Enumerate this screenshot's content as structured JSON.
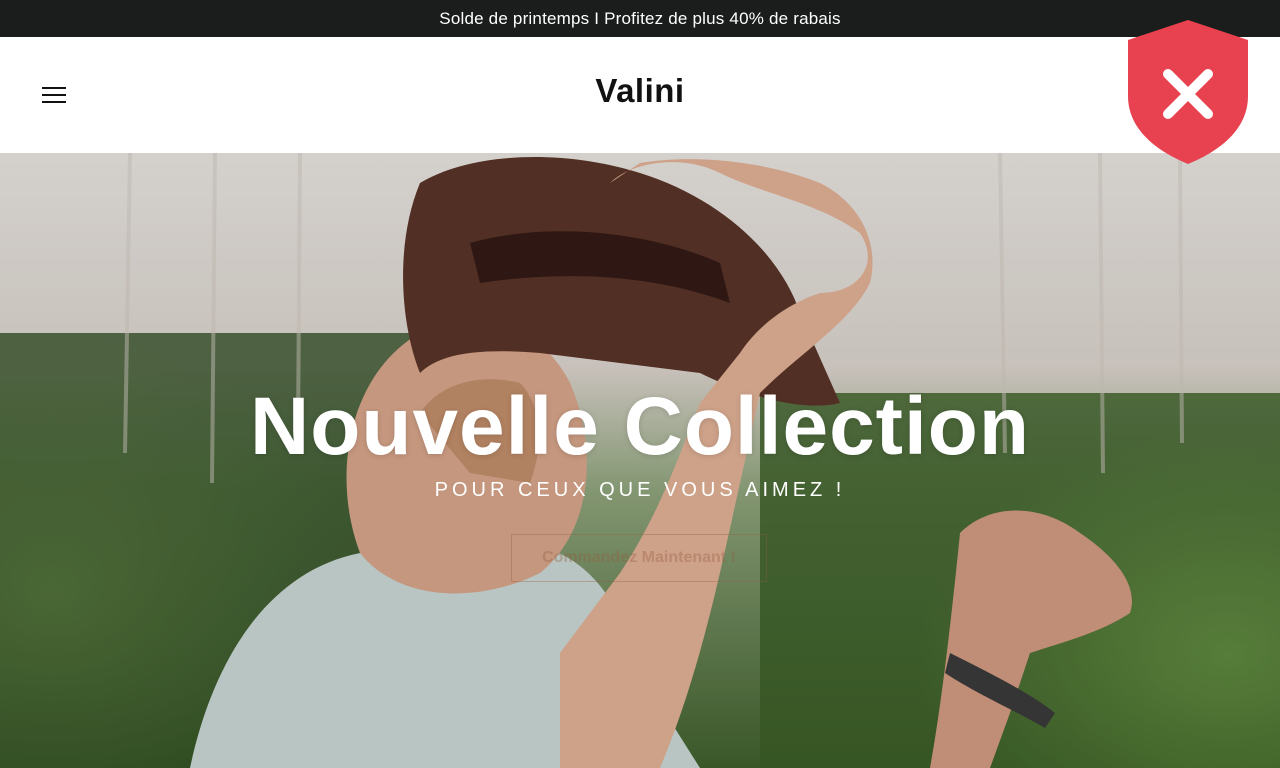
{
  "announcement": {
    "text": "Solde de printemps I Profitez de plus 40% de rabais"
  },
  "header": {
    "logo_text": "Valini",
    "menu_icon": "hamburger-menu-icon"
  },
  "security_badge": {
    "icon": "shield-x-icon",
    "color": "#e8414f"
  },
  "hero": {
    "title": "Nouvelle Collection",
    "subtitle": "POUR CEUX QUE VOUS AIMEZ !",
    "cta_label": "Commandez Maintenant !"
  },
  "colors": {
    "announcement_bg": "#1b1c1c",
    "header_bg": "#ffffff",
    "text_on_hero": "#ffffff"
  }
}
